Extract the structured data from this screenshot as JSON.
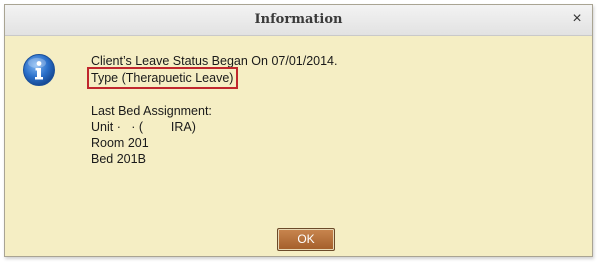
{
  "dialog": {
    "title": "Information",
    "close_glyph": "×",
    "icon": "info-icon",
    "message": {
      "line1": "Client’s Leave Status Began On 07/01/2014.",
      "line2": "Type (Therapuetic Leave)",
      "line3": "Last Bed Assignment:",
      "line4": "Unit ·   · (        IRA)",
      "line5": "Room 201",
      "line6": "Bed 201B"
    },
    "ok_label": "OK"
  },
  "colors": {
    "dialog_background": "#f5eec4",
    "highlight_border": "#c0272d",
    "ok_button": "#b06a35",
    "info_icon": "#2a6fc9"
  }
}
